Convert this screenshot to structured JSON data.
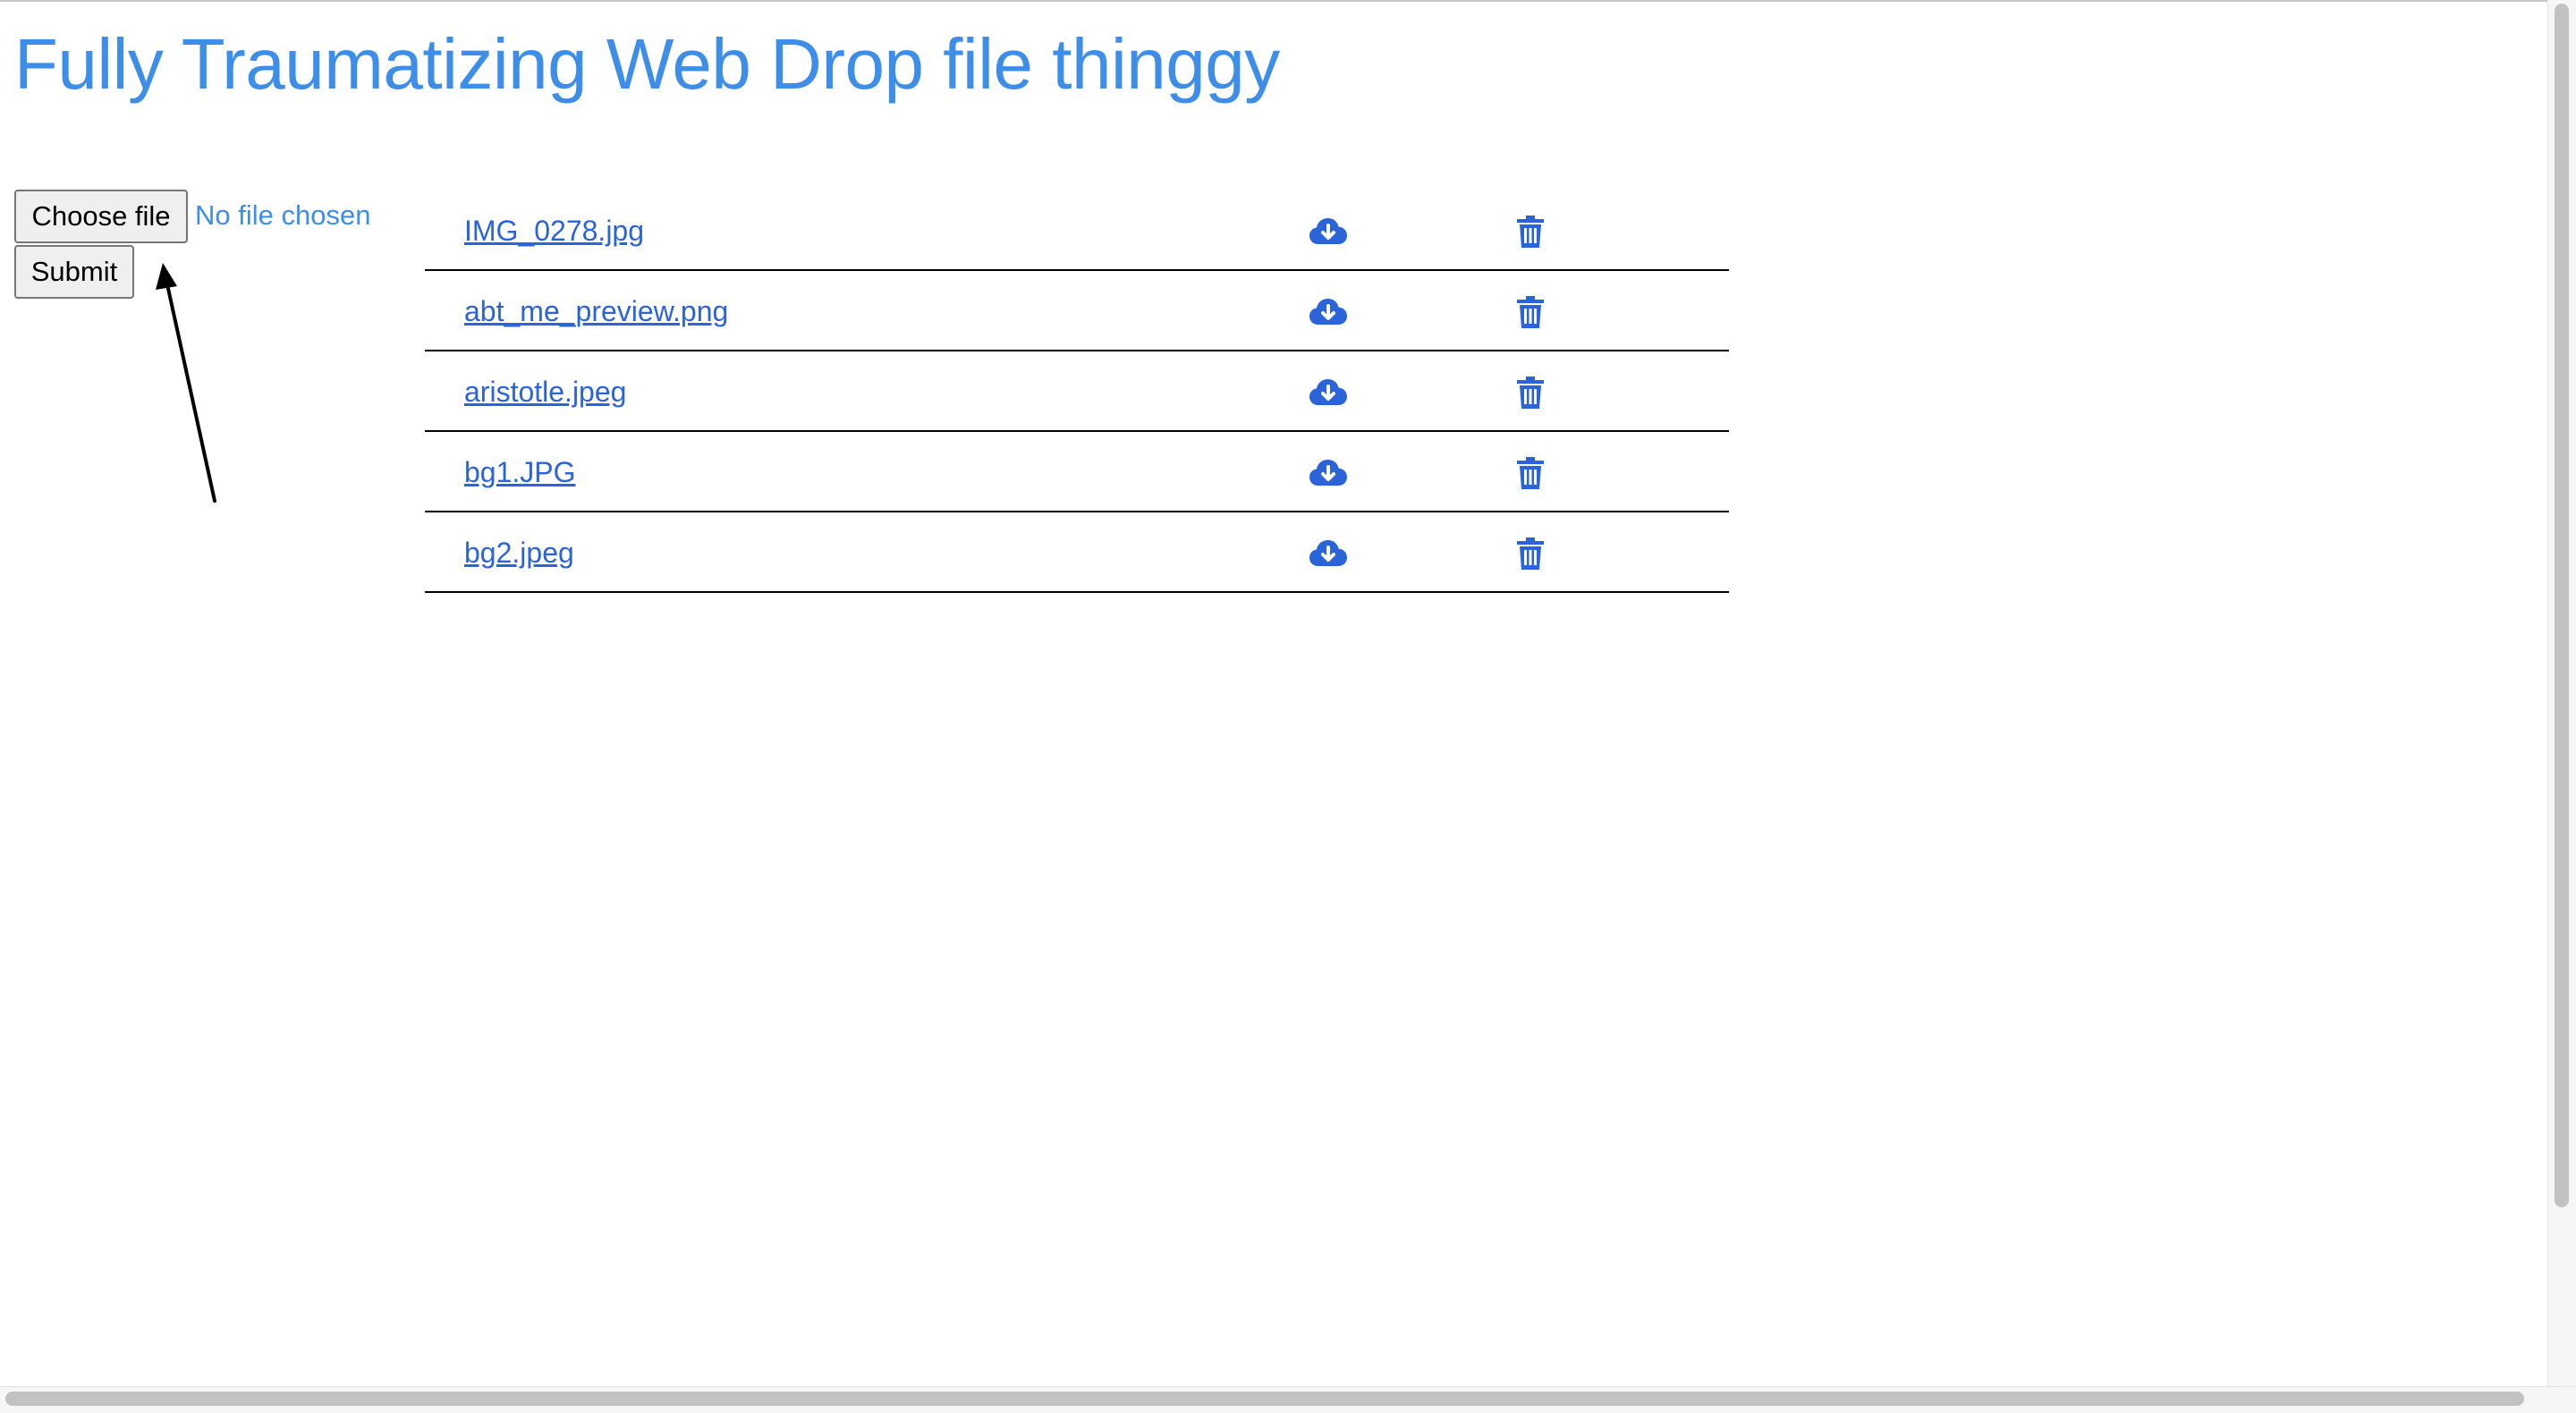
{
  "page": {
    "title": "Fully Traumatizing Web Drop file thinggy"
  },
  "upload": {
    "choose_label": "Choose file",
    "file_status": "No file chosen",
    "submit_label": "Submit"
  },
  "files": [
    {
      "name": "IMG_0278.jpg"
    },
    {
      "name": "abt_me_preview.png"
    },
    {
      "name": "aristotle.jpeg"
    },
    {
      "name": "bg1.JPG"
    },
    {
      "name": "bg2.jpeg"
    }
  ],
  "icons": {
    "download": "cloud-download-icon",
    "delete": "trash-icon"
  },
  "colors": {
    "title": "#3d8ee8",
    "link": "#2b63d9",
    "icon": "#2b63d9"
  }
}
